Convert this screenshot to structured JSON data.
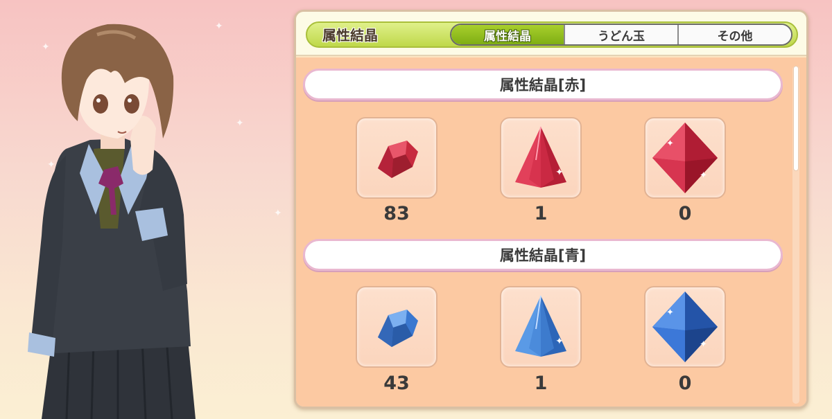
{
  "panel": {
    "title": "属性結晶",
    "tabs": [
      {
        "label": "属性結晶",
        "active": true
      },
      {
        "label": "うどん玉",
        "active": false
      },
      {
        "label": "その他",
        "active": false
      }
    ],
    "sections": [
      {
        "title": "属性結晶[赤]",
        "color": "#d8334a",
        "items": [
          {
            "icon": "red-crystal-fragment-icon",
            "count": "83"
          },
          {
            "icon": "red-crystal-pyramid-icon",
            "count": "1"
          },
          {
            "icon": "red-crystal-octahedron-icon",
            "count": "0"
          }
        ]
      },
      {
        "title": "属性結晶[青]",
        "color": "#3a7fdc",
        "items": [
          {
            "icon": "blue-crystal-fragment-icon",
            "count": "43"
          },
          {
            "icon": "blue-crystal-pyramid-icon",
            "count": "1"
          },
          {
            "icon": "blue-crystal-octahedron-icon",
            "count": "0"
          }
        ]
      }
    ]
  },
  "character": {
    "icon": "student-character-portrait"
  }
}
